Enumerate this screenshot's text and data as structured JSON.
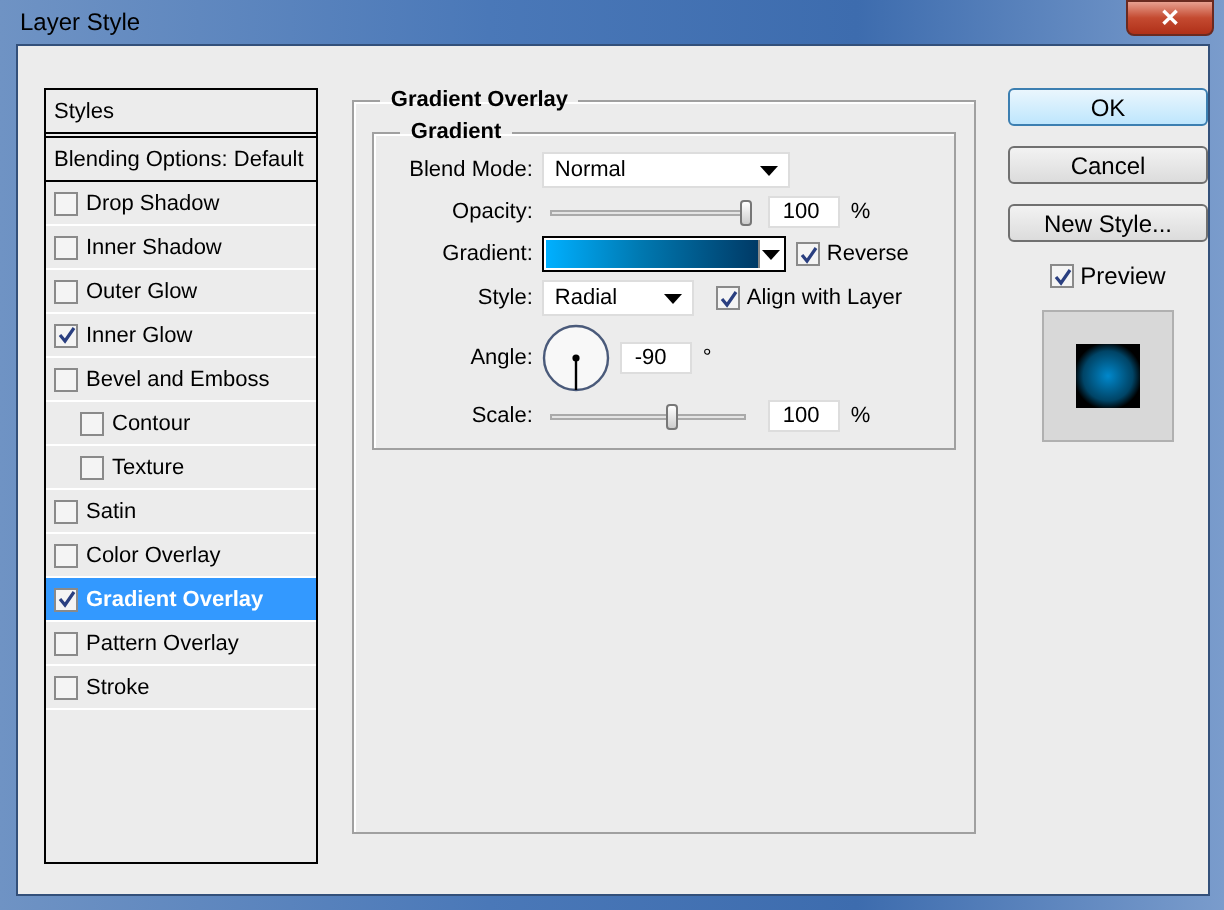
{
  "window": {
    "title": "Layer Style",
    "close": "✕"
  },
  "styles_panel": {
    "items": [
      {
        "kind": "header",
        "label": "Styles",
        "selected": false
      },
      {
        "kind": "option",
        "label": "Blending Options: Default",
        "selected": false
      },
      {
        "kind": "effect",
        "label": "Drop Shadow",
        "checked": false,
        "selected": false
      },
      {
        "kind": "effect",
        "label": "Inner Shadow",
        "checked": false,
        "selected": false
      },
      {
        "kind": "effect",
        "label": "Outer Glow",
        "checked": false,
        "selected": false
      },
      {
        "kind": "effect",
        "label": "Inner Glow",
        "checked": true,
        "selected": false
      },
      {
        "kind": "effect",
        "label": "Bevel and Emboss",
        "checked": false,
        "selected": false,
        "children": [
          {
            "kind": "effect",
            "label": "Contour",
            "checked": false,
            "selected": false
          },
          {
            "kind": "effect",
            "label": "Texture",
            "checked": false,
            "selected": false
          }
        ]
      },
      {
        "kind": "effect",
        "label": "Satin",
        "checked": false,
        "selected": false
      },
      {
        "kind": "effect",
        "label": "Color Overlay",
        "checked": false,
        "selected": false
      },
      {
        "kind": "effect",
        "label": "Gradient Overlay",
        "checked": true,
        "selected": true
      },
      {
        "kind": "effect",
        "label": "Pattern Overlay",
        "checked": false,
        "selected": false
      },
      {
        "kind": "effect",
        "label": "Stroke",
        "checked": false,
        "selected": false
      }
    ]
  },
  "gradient_overlay": {
    "title": "Gradient Overlay",
    "group_title": "Gradient",
    "blend_mode": {
      "label": "Blend Mode:",
      "value": "Normal"
    },
    "opacity": {
      "label": "Opacity:",
      "level": 1.0,
      "value": "100",
      "unit": "%"
    },
    "gradient": {
      "label": "Gradient:",
      "reverse": {
        "label": "Reverse",
        "checked": true
      }
    },
    "style": {
      "label": "Style:",
      "value": "Radial",
      "align_with_layer": {
        "label": "Align with Layer",
        "checked": true
      }
    },
    "angle": {
      "label": "Angle:",
      "value": "-90",
      "unit": "°"
    },
    "scale": {
      "label": "Scale:",
      "level": 0.62,
      "value": "100",
      "unit": "%"
    }
  },
  "buttons": [
    {
      "label": "OK",
      "default": true
    },
    {
      "label": "Cancel",
      "default": false
    },
    {
      "label": "New Style...",
      "default": false
    }
  ],
  "preview": {
    "label": "Preview",
    "checked": true
  }
}
